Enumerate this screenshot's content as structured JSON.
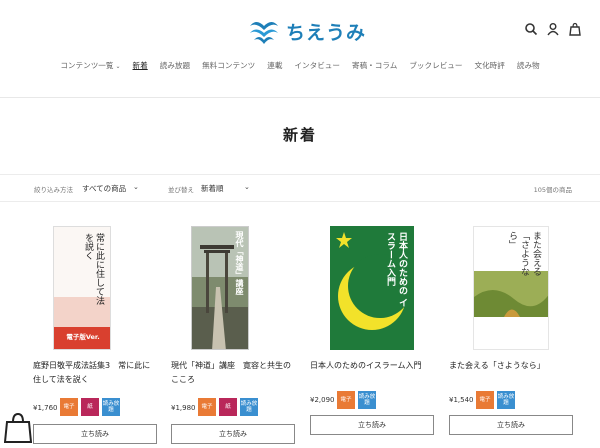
{
  "header": {
    "logo_text": "ちえうみ",
    "icons": [
      "search-icon",
      "account-icon",
      "cart-icon"
    ]
  },
  "nav": {
    "items": [
      {
        "label": "コンテンツ一覧"
      },
      {
        "label": "新着"
      },
      {
        "label": "読み放題"
      },
      {
        "label": "無料コンテンツ"
      },
      {
        "label": "連載"
      },
      {
        "label": "インタビュー"
      },
      {
        "label": "寄稿・コラム"
      },
      {
        "label": "ブックレビュー"
      },
      {
        "label": "文化時評"
      },
      {
        "label": "読み物"
      }
    ],
    "active": "新着"
  },
  "page_title": "新着",
  "filter": {
    "filter_label": "絞り込み方法",
    "filter_value": "すべての商品",
    "sort_label": "並び替え",
    "sort_value": "新着順",
    "count_text": "105個の商品"
  },
  "products": [
    {
      "title": "庭野日敬平成法話集3　常に此に住して法を説く",
      "price": "¥1,760",
      "badges": [
        "電子",
        "紙",
        "読み放題"
      ],
      "cover": {
        "main_text": "常に此に住して法を説く",
        "band_text": "電子版Ver."
      },
      "read_label": "立ち読み"
    },
    {
      "title": "現代「神道」講座　寛容と共生のこころ",
      "price": "¥1,980",
      "badges": [
        "電子",
        "紙",
        "読み放題"
      ],
      "cover": {
        "main_text": "現代「神道」講座"
      },
      "read_label": "立ち読み"
    },
    {
      "title": "日本人のためのイスラーム入門",
      "price": "¥2,090",
      "badges": [
        "電子",
        "読み放題"
      ],
      "cover": {
        "main_text": "日本人のための イスラーム入門"
      },
      "read_label": "立ち読み"
    },
    {
      "title": "また会える「さようなら」",
      "price": "¥1,540",
      "badges": [
        "電子",
        "読み放題"
      ],
      "cover": {
        "main_text": "また会える「さようなら」"
      },
      "read_label": "立ち読み"
    }
  ],
  "colors": {
    "accent_orange": "#e97a35",
    "accent_pink": "#b9275a",
    "accent_blue": "#3a8fd0",
    "logo_blue": "#1e7fb8"
  }
}
